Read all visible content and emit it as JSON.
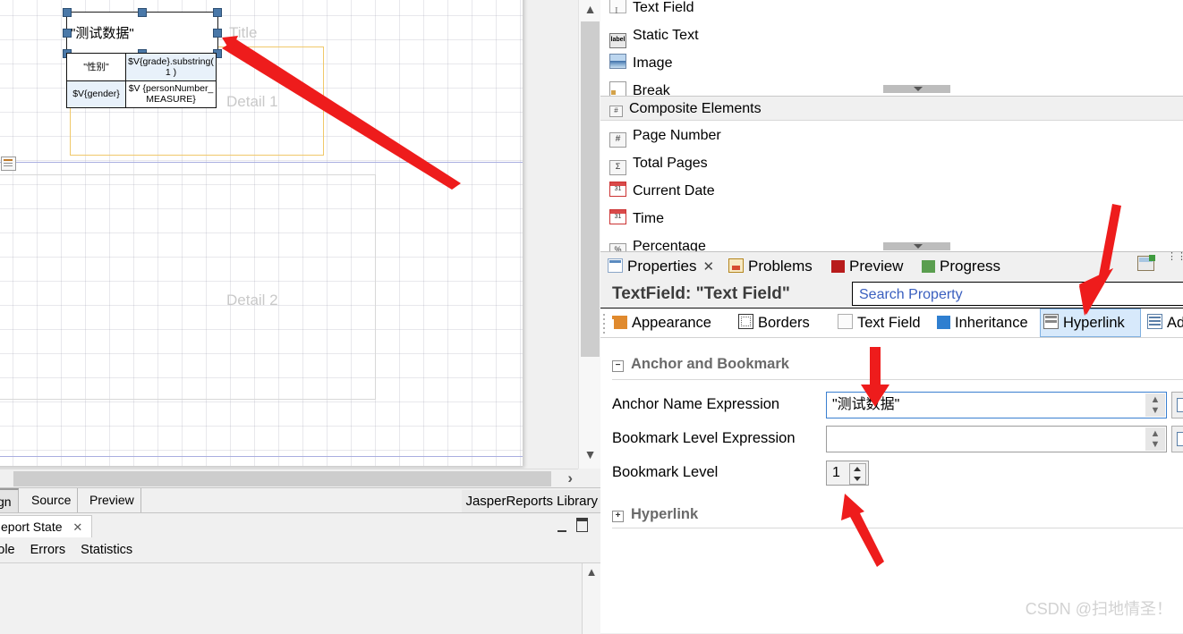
{
  "canvas": {
    "selected_element_text": "\"测试数据\"",
    "table": {
      "rows": [
        [
          "\"性别\"",
          "$V{grade}.substring( 1 )"
        ],
        [
          "$V{gender}",
          "$V {personNumber_MEASURE}"
        ]
      ]
    },
    "bands": [
      {
        "label": "Title"
      },
      {
        "label": "Detail 1"
      },
      {
        "label": "Detail 2"
      }
    ]
  },
  "editor_tabs": {
    "items": [
      {
        "label": "gn",
        "active": true
      },
      {
        "label": "Source",
        "active": false
      },
      {
        "label": "Preview",
        "active": false
      }
    ],
    "library_label": "JasperReports Library"
  },
  "report_state": {
    "tab_label": "eport State",
    "close_glyph": "✕",
    "subtabs": [
      "sole",
      "Errors",
      "Statistics"
    ]
  },
  "palette": {
    "items": [
      {
        "label": "Text Field",
        "icon": "textfield-icon",
        "kind": "item"
      },
      {
        "label": "Static Text",
        "icon": "static-text-icon",
        "kind": "item"
      },
      {
        "label": "Image",
        "icon": "image-icon",
        "kind": "item"
      },
      {
        "label": "Break",
        "icon": "break-icon",
        "kind": "item"
      },
      {
        "label": "Composite Elements",
        "icon": "composite-icon",
        "kind": "group"
      },
      {
        "label": "Page Number",
        "icon": "page-number-icon",
        "kind": "item"
      },
      {
        "label": "Total Pages",
        "icon": "total-pages-icon",
        "kind": "item"
      },
      {
        "label": "Current Date",
        "icon": "current-date-icon",
        "kind": "item"
      },
      {
        "label": "Time",
        "icon": "time-icon",
        "kind": "item"
      },
      {
        "label": "Percentage",
        "icon": "percentage-icon",
        "kind": "item"
      }
    ],
    "group_icon_glyph": "#",
    "static_icon_glyph": "label",
    "hash_glyph": "#",
    "sigma_glyph": "Σ",
    "pct_glyph": "%"
  },
  "properties": {
    "view_tabs": [
      {
        "label": "Properties",
        "icon": "properties-icon",
        "active": true,
        "closable": true
      },
      {
        "label": "Problems",
        "icon": "problems-icon",
        "active": false,
        "closable": false
      },
      {
        "label": "Preview",
        "icon": "preview-icon",
        "active": false,
        "closable": false
      },
      {
        "label": "Progress",
        "icon": "progress-icon",
        "active": false,
        "closable": false
      }
    ],
    "close_glyph": "✕",
    "title": "TextField: \"Text Field\"",
    "search": {
      "value": "",
      "placeholder": "Search Property"
    },
    "category_tabs": [
      {
        "label": "Appearance",
        "icon": "appearance-icon",
        "active": false
      },
      {
        "label": "Borders",
        "icon": "borders-icon",
        "active": false
      },
      {
        "label": "Text Field",
        "icon": "text-field-icon",
        "active": false
      },
      {
        "label": "Inheritance",
        "icon": "inheritance-icon",
        "active": false
      },
      {
        "label": "Hyperlink",
        "icon": "hyperlink-icon",
        "active": true
      },
      {
        "label": "Ad",
        "icon": "advanced-icon",
        "active": false
      }
    ],
    "sections": [
      {
        "title": "Anchor and Bookmark",
        "toggle": "−",
        "expanded": true,
        "fields": [
          {
            "label": "Anchor Name Expression",
            "value": "\"测试数据\"",
            "type": "expression",
            "focused": true
          },
          {
            "label": "Bookmark Level Expression",
            "value": "",
            "type": "expression",
            "focused": false
          },
          {
            "label": "Bookmark Level",
            "value": "1",
            "type": "number",
            "focused": false
          }
        ]
      },
      {
        "title": "Hyperlink",
        "toggle": "+",
        "expanded": false,
        "fields": []
      }
    ]
  },
  "watermark": "CSDN @扫地情圣！",
  "colors": {
    "accent_selection": "#d7e9fb",
    "arrow_red": "#ee1c1c",
    "field_focus_border": "#3a7fd0",
    "band_outline": "#f0c86a",
    "search_text": "#3a5fbf"
  }
}
